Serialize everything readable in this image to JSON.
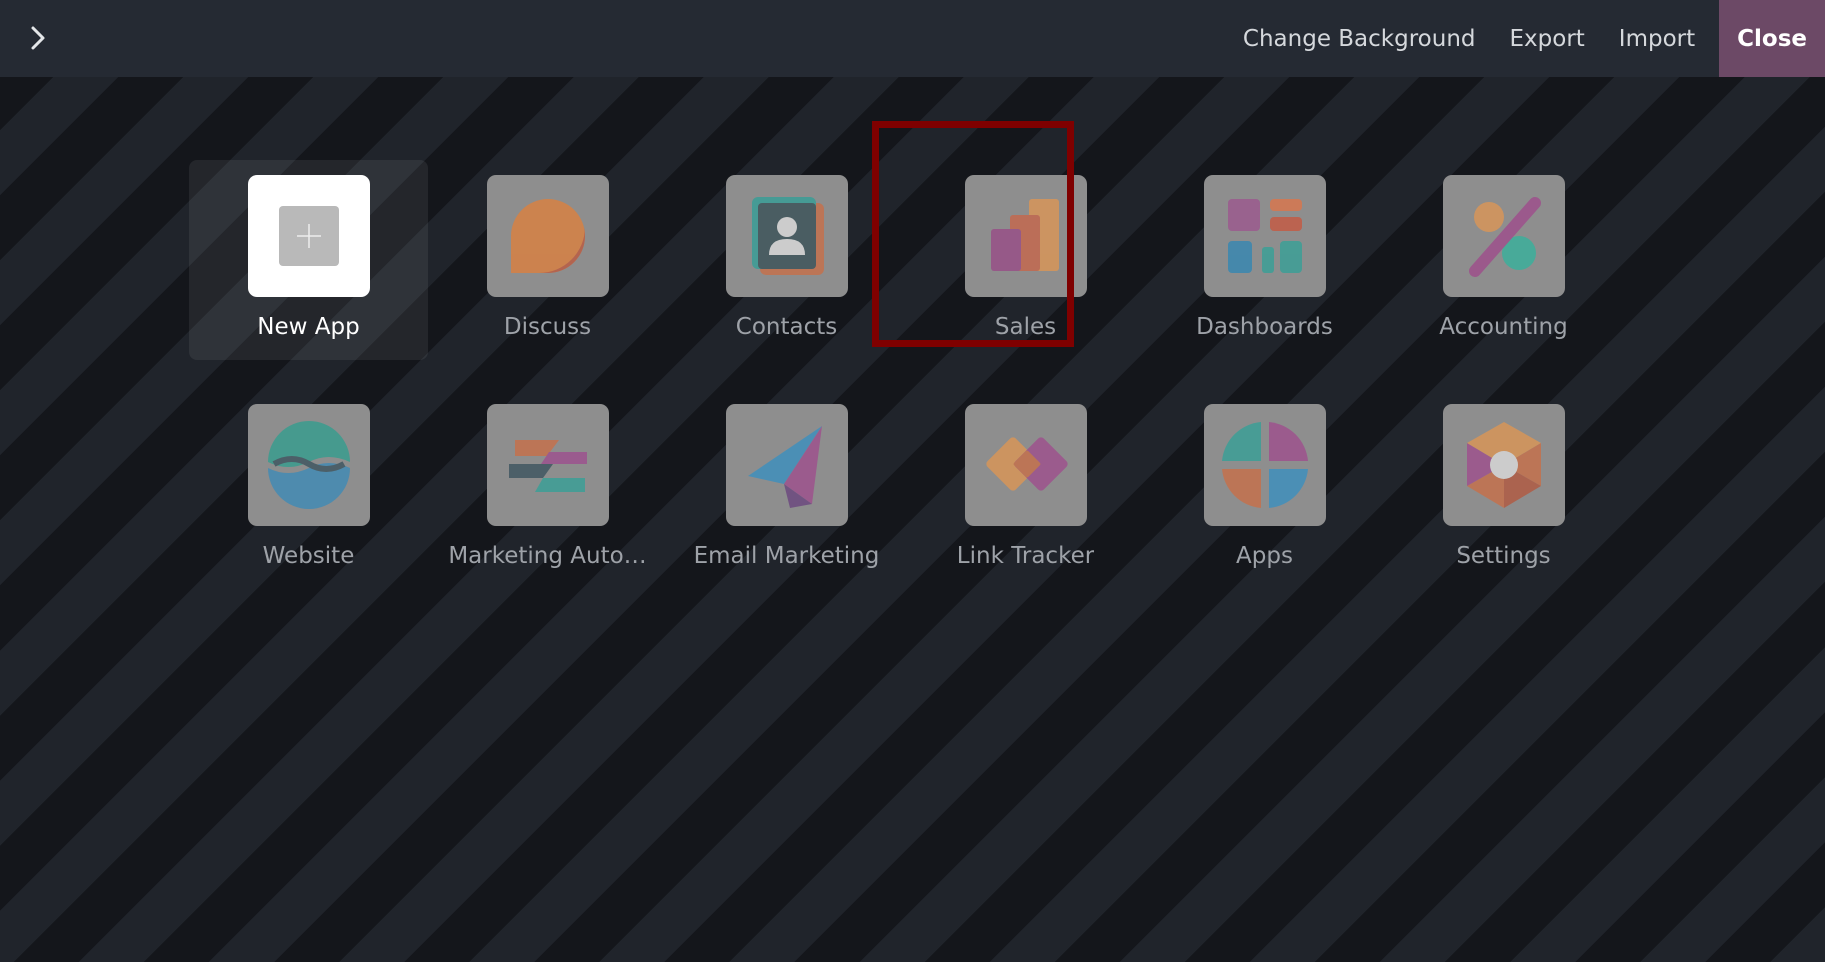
{
  "topbar": {
    "toggle_icon": "chevron-right-icon",
    "change_background": "Change Background",
    "export": "Export",
    "import": "Import",
    "close": "Close"
  },
  "apps": [
    {
      "label": "New App",
      "icon": "new-app-icon"
    },
    {
      "label": "Discuss",
      "icon": "discuss-icon"
    },
    {
      "label": "Contacts",
      "icon": "contacts-icon"
    },
    {
      "label": "Sales",
      "icon": "sales-icon"
    },
    {
      "label": "Dashboards",
      "icon": "dashboards-icon"
    },
    {
      "label": "Accounting",
      "icon": "accounting-icon"
    },
    {
      "label": "Website",
      "icon": "website-icon"
    },
    {
      "label": "Marketing Auto…",
      "icon": "marketing-automation-icon"
    },
    {
      "label": "Email Marketing",
      "icon": "email-marketing-icon"
    },
    {
      "label": "Link Tracker",
      "icon": "link-tracker-icon"
    },
    {
      "label": "Apps",
      "icon": "apps-icon"
    },
    {
      "label": "Settings",
      "icon": "settings-icon"
    }
  ],
  "colors": {
    "topbar": "#252a33",
    "close_button": "#6c4966",
    "highlight_border": "#7f0000"
  }
}
